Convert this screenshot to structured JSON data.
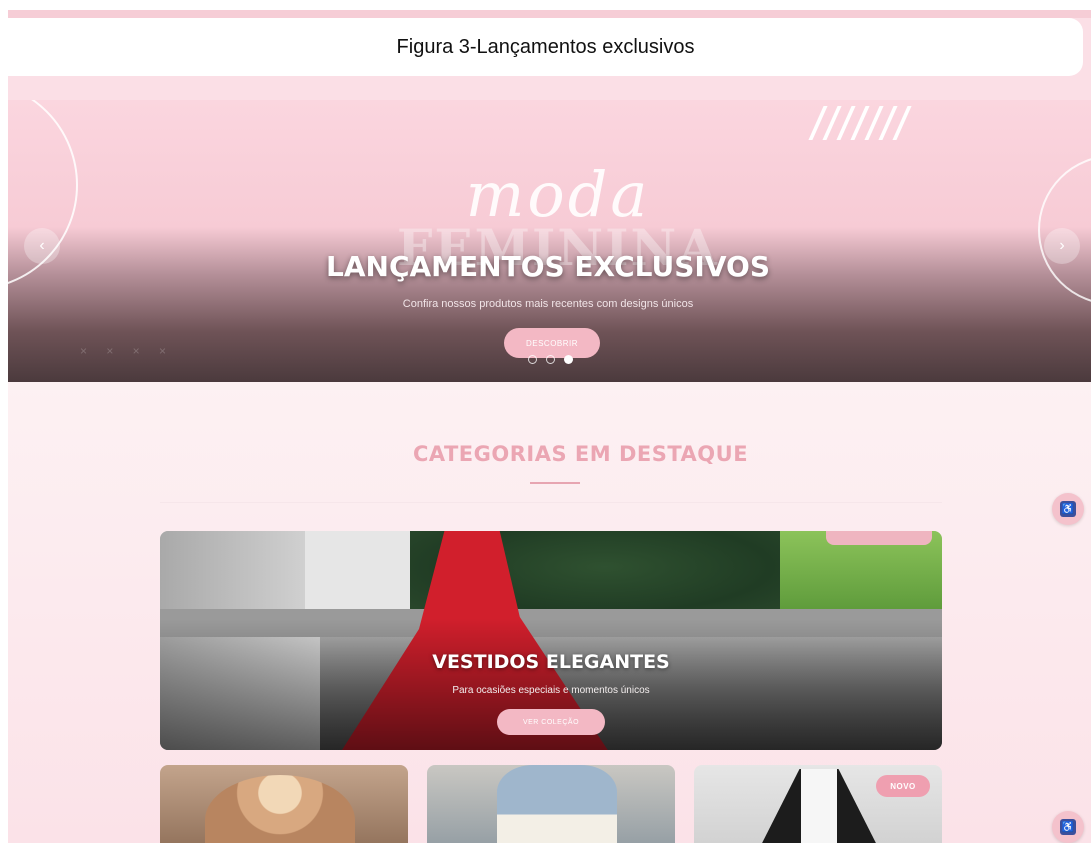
{
  "caption": {
    "text": "Figura 3-Lançamentos exclusivos"
  },
  "hero": {
    "script_word": "moda",
    "big_word": "FEMININA",
    "title": "LANÇAMENTOS EXCLUSIVOS",
    "subtitle": "Confira nossos produtos mais recentes com designs únicos",
    "button_label": "DESCOBRIR",
    "prev_arrow": "‹",
    "next_arrow": "›",
    "slides": [
      {
        "active": false
      },
      {
        "active": false
      },
      {
        "active": true
      }
    ]
  },
  "categories": {
    "heading": "CATEGORIAS EM DESTAQUE",
    "featured": {
      "title": "VESTIDOS ELEGANTES",
      "subtitle": "Para ocasiões especiais e momentos únicos",
      "button_label": "VER COLEÇÃO"
    },
    "thumbnails": [
      {
        "badge": ""
      },
      {
        "badge": ""
      },
      {
        "badge": "NOVO"
      }
    ]
  },
  "accessibility": {
    "icon": "accessibility-icon",
    "glyph": "♿"
  },
  "colors": {
    "accent_pink": "#f3b8c4",
    "heading_pink": "#eba6b3",
    "badge_pink": "#ef9fb0",
    "accessibility_blue": "#3b4f9c"
  }
}
